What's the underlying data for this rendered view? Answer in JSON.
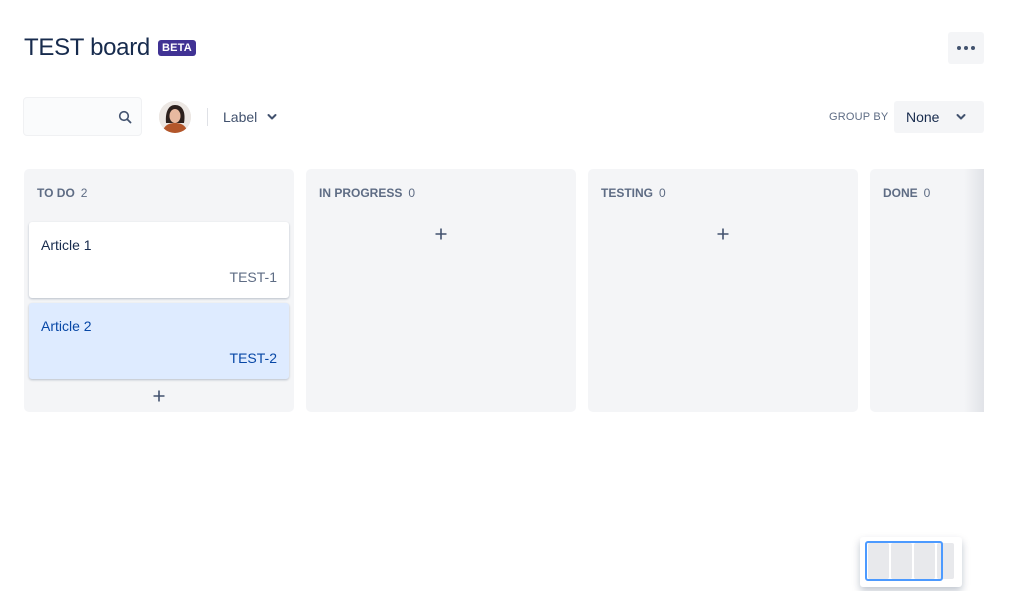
{
  "header": {
    "title": "TEST board",
    "badge": "BETA",
    "more_button_icon": "more-horizontal-icon"
  },
  "filters": {
    "search": {
      "value": "",
      "placeholder": "",
      "icon": "search-icon"
    },
    "avatar": {
      "icon": "user-avatar"
    },
    "label_filter": "Label",
    "group_by_label": "GROUP BY",
    "group_by_value": "None"
  },
  "columns": [
    {
      "name": "TO DO",
      "count": "2",
      "cards": [
        {
          "title": "Article 1",
          "key": "TEST-1",
          "selected": false
        },
        {
          "title": "Article 2",
          "key": "TEST-2",
          "selected": true
        }
      ]
    },
    {
      "name": "IN PROGRESS",
      "count": "0",
      "cards": []
    },
    {
      "name": "TESTING",
      "count": "0",
      "cards": []
    },
    {
      "name": "DONE",
      "count": "0",
      "cards": []
    }
  ],
  "colors": {
    "badge": "#403294",
    "selected_card": "#deebff",
    "selected_text": "#0747a6",
    "column_bg": "#f4f5f7",
    "minimap_viewport": "#4c9aff"
  }
}
